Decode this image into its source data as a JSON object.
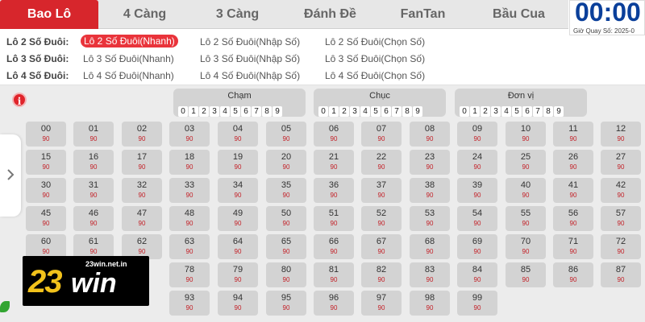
{
  "tabs": [
    "Bao Lô",
    "4 Càng",
    "3 Càng",
    "Đánh Đề",
    "FanTan",
    "Bầu Cua"
  ],
  "timer": {
    "value": "00:00",
    "label": "Giờ Quay Số: 2025-0"
  },
  "bet_types": [
    {
      "label": "Lô 2 Số Đuôi:",
      "options": [
        "Lô 2 Số Đuôi(Nhanh)",
        "Lô 2 Số Đuôi(Nhập Số)",
        "Lô 2 Số Đuôi(Chọn Số)"
      ]
    },
    {
      "label": "Lô 3 Số Đuôi:",
      "options": [
        "Lô 3 Số Đuôi(Nhanh)",
        "Lô 3 Số Đuôi(Nhập Số)",
        "Lô 3 Số Đuôi(Chọn Số)"
      ]
    },
    {
      "label": "Lô 4 Số Đuôi:",
      "options": [
        "Lô 4 Số Đuôi(Nhanh)",
        "Lô 4 Số Đuôi(Nhập Số)",
        "Lô 4 Số Đuôi(Chọn Số)"
      ]
    }
  ],
  "info_icon": "i",
  "filters": [
    {
      "title": "Chạm",
      "digits": [
        "0",
        "1",
        "2",
        "3",
        "4",
        "5",
        "6",
        "7",
        "8",
        "9"
      ]
    },
    {
      "title": "Chục",
      "digits": [
        "0",
        "1",
        "2",
        "3",
        "4",
        "5",
        "6",
        "7",
        "8",
        "9"
      ]
    },
    {
      "title": "Đơn vị",
      "digits": [
        "0",
        "1",
        "2",
        "3",
        "4",
        "5",
        "6",
        "7",
        "8",
        "9"
      ]
    }
  ],
  "numbers": [
    "00",
    "01",
    "02",
    "03",
    "04",
    "05",
    "06",
    "07",
    "08",
    "09",
    "10",
    "11",
    "12",
    "15",
    "16",
    "17",
    "18",
    "19",
    "20",
    "21",
    "22",
    "23",
    "24",
    "25",
    "26",
    "27",
    "30",
    "31",
    "32",
    "33",
    "34",
    "35",
    "36",
    "37",
    "38",
    "39",
    "40",
    "41",
    "42",
    "45",
    "46",
    "47",
    "48",
    "49",
    "50",
    "51",
    "52",
    "53",
    "54",
    "55",
    "56",
    "57",
    "60",
    "61",
    "62",
    "63",
    "64",
    "65",
    "66",
    "67",
    "68",
    "69",
    "70",
    "71",
    "72",
    "78",
    "79",
    "80",
    "81",
    "82",
    "83",
    "84",
    "85",
    "86",
    "87",
    "93",
    "94",
    "95",
    "96",
    "97",
    "98",
    "99"
  ],
  "odds": "90",
  "logo": {
    "url": "23win.net.in",
    "text_23": "23",
    "text_win": "win"
  },
  "icons": {
    "arrow": "chevron-right-icon",
    "info": "info-icon"
  },
  "colors": {
    "accent": "#d7262c",
    "timer": "#0a3f9a",
    "odds": "#c31f26",
    "logo_yellow": "#f2c21b"
  }
}
